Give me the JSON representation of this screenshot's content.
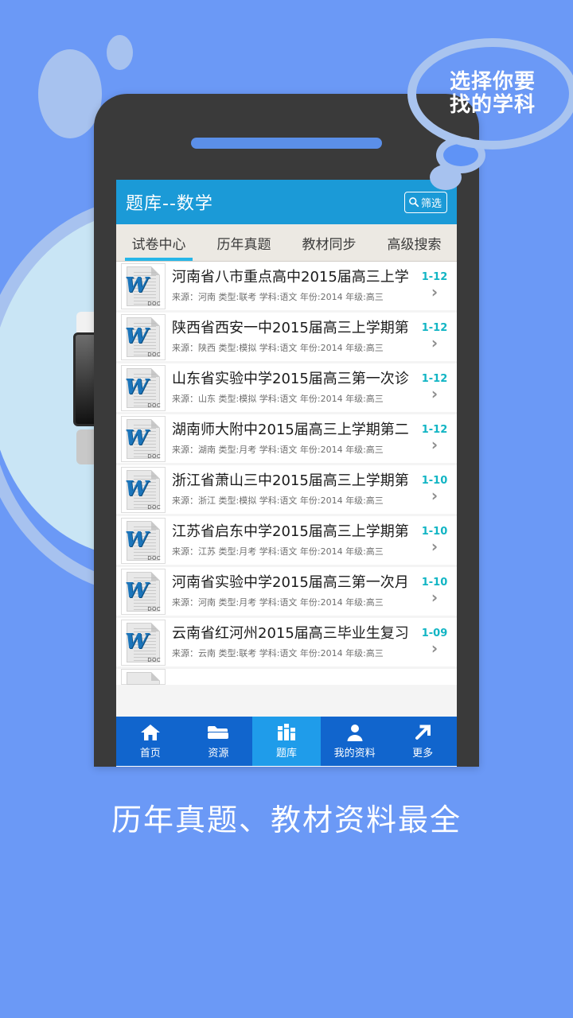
{
  "promo": {
    "bubble_line1": "选择你要",
    "bubble_line2": "找的学科",
    "caption": "历年真题、教材资料最全"
  },
  "colors": {
    "background": "#6b99f6",
    "deco": "#a7c2ef",
    "phone_body": "#3a3a3a",
    "header_blue": "#1b9ad7",
    "tab_bar": "#ece9e3",
    "tab_underline": "#26b6e8",
    "nav_blue": "#1165cd",
    "nav_active_blue": "#1f9cea",
    "date_teal": "#12b5c4",
    "doc_blue": "#1b75bb"
  },
  "app": {
    "header": {
      "title": "题库--数学",
      "filter_label": "筛选",
      "filter_icon": "search-icon"
    },
    "tabs": [
      {
        "label": "试卷中心",
        "active": true
      },
      {
        "label": "历年真题",
        "active": false
      },
      {
        "label": "教材同步",
        "active": false
      },
      {
        "label": "高级搜索",
        "active": false
      }
    ],
    "list": [
      {
        "icon": "word-doc-icon",
        "icon_tag": "DOC",
        "title": "河南省八市重点高中2015届高三上学",
        "meta": "来源：河南 类型:联考 学科:语文 年份:2014 年级:高三",
        "date": "1-12",
        "chevron": "chevron-right-icon"
      },
      {
        "icon": "word-doc-icon",
        "icon_tag": "DOC",
        "title": "陕西省西安一中2015届高三上学期第",
        "meta": "来源：陕西 类型:模拟 学科:语文 年份:2014 年级:高三",
        "date": "1-12",
        "chevron": "chevron-right-icon"
      },
      {
        "icon": "word-doc-icon",
        "icon_tag": "DOC",
        "title": "山东省实验中学2015届高三第一次诊",
        "meta": "来源：山东 类型:模拟 学科:语文 年份:2014 年级:高三",
        "date": "1-12",
        "chevron": "chevron-right-icon"
      },
      {
        "icon": "word-doc-icon",
        "icon_tag": "DOC",
        "title": "湖南师大附中2015届高三上学期第二",
        "meta": "来源：湖南 类型:月考 学科:语文 年份:2014 年级:高三",
        "date": "1-12",
        "chevron": "chevron-right-icon"
      },
      {
        "icon": "word-doc-icon",
        "icon_tag": "DOC",
        "title": "浙江省萧山三中2015届高三上学期第",
        "meta": "来源：浙江 类型:模拟 学科:语文 年份:2014 年级:高三",
        "date": "1-10",
        "chevron": "chevron-right-icon"
      },
      {
        "icon": "word-doc-icon",
        "icon_tag": "DOC",
        "title": "江苏省启东中学2015届高三上学期第",
        "meta": "来源：江苏 类型:月考 学科:语文 年份:2014 年级:高三",
        "date": "1-10",
        "chevron": "chevron-right-icon"
      },
      {
        "icon": "word-doc-icon",
        "icon_tag": "DOC",
        "title": "河南省实验中学2015届高三第一次月",
        "meta": "来源：河南 类型:月考 学科:语文 年份:2014 年级:高三",
        "date": "1-10",
        "chevron": "chevron-right-icon"
      },
      {
        "icon": "word-doc-icon",
        "icon_tag": "DOC",
        "title": "云南省红河州2015届高三毕业生复习",
        "meta": "来源：云南 类型:联考 学科:语文 年份:2014 年级:高三",
        "date": "1-09",
        "chevron": "chevron-right-icon"
      }
    ],
    "bottom_nav": [
      {
        "label": "首页",
        "icon": "home-icon",
        "active": false
      },
      {
        "label": "资源",
        "icon": "folder-icon",
        "active": false
      },
      {
        "label": "题库",
        "icon": "books-icon",
        "active": true
      },
      {
        "label": "我的资料",
        "icon": "person-icon",
        "active": false
      },
      {
        "label": "更多",
        "icon": "arrow-up-right-icon",
        "active": false
      }
    ]
  }
}
